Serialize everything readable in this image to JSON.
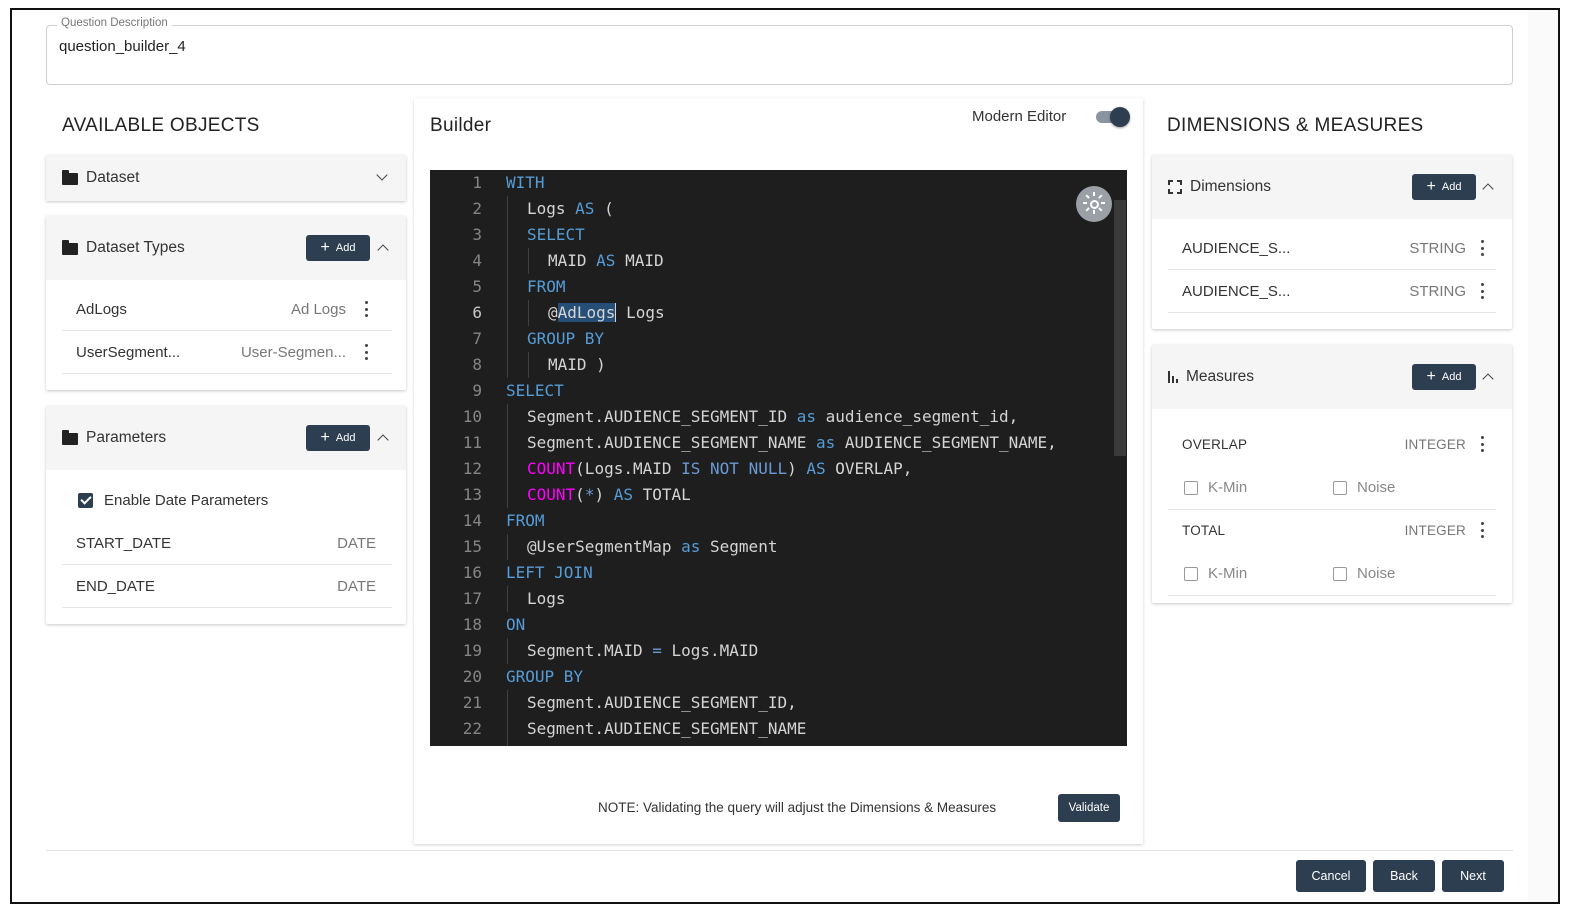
{
  "question": {
    "label": "Question Description",
    "value": "question_builder_4"
  },
  "available_objects": {
    "title": "AVAILABLE OBJECTS",
    "dataset": {
      "label": "Dataset"
    },
    "dataset_types": {
      "label": "Dataset Types",
      "add_label": "Add",
      "items": [
        {
          "name": "AdLogs",
          "type": "Ad Logs"
        },
        {
          "name": "UserSegment...",
          "type": "User-Segmen..."
        }
      ]
    },
    "parameters": {
      "label": "Parameters",
      "add_label": "Add",
      "enable_label": "Enable Date Parameters",
      "items": [
        {
          "name": "START_DATE",
          "type": "DATE"
        },
        {
          "name": "END_DATE",
          "type": "DATE"
        }
      ]
    }
  },
  "builder": {
    "title": "Builder",
    "toggle_label": "Modern Editor",
    "note": "NOTE: Validating the query will adjust the Dimensions & Measures",
    "validate_label": "Validate",
    "line_numbers": [
      "1",
      "2",
      "3",
      "4",
      "5",
      "6",
      "7",
      "8",
      "9",
      "10",
      "11",
      "12",
      "13",
      "14",
      "15",
      "16",
      "17",
      "18",
      "19",
      "20",
      "21",
      "22"
    ],
    "code": {
      "l1": {
        "kw": "WITH"
      },
      "l2": {
        "a": "Logs ",
        "kw": "AS",
        "b": " ("
      },
      "l3": {
        "kw": "SELECT"
      },
      "l4": {
        "a": "MAID ",
        "kw": "AS",
        "b": " MAID"
      },
      "l5": {
        "kw": "FROM"
      },
      "l6": {
        "a": "@",
        "sel": "AdLogs",
        "b": " Logs"
      },
      "l7": {
        "kw": "GROUP BY"
      },
      "l8": {
        "a": "MAID )"
      },
      "l9": {
        "kw": "SELECT"
      },
      "l10": {
        "a": "Segment.AUDIENCE_SEGMENT_ID ",
        "kw": "as",
        "b": " audience_segment_id,"
      },
      "l11": {
        "a": "Segment.AUDIENCE_SEGMENT_NAME ",
        "kw": "as",
        "b": " AUDIENCE_SEGMENT_NAME,"
      },
      "l12": {
        "fn": "COUNT",
        "a": "(Logs.MAID ",
        "op": "IS NOT NULL",
        "b": ") ",
        "kw": "AS",
        "c": " OVERLAP,"
      },
      "l13": {
        "fn": "COUNT",
        "a": "(",
        "op": "*",
        "b": ") ",
        "kw": "AS",
        "c": " TOTAL"
      },
      "l14": {
        "kw": "FROM"
      },
      "l15": {
        "a": "@UserSegmentMap ",
        "kw": "as",
        "b": " Segment"
      },
      "l16": {
        "kw": "LEFT JOIN"
      },
      "l17": {
        "a": "Logs"
      },
      "l18": {
        "kw": "ON"
      },
      "l19": {
        "a": "Segment.MAID ",
        "op": "=",
        "b": " Logs.MAID"
      },
      "l20": {
        "kw": "GROUP BY"
      },
      "l21": {
        "a": "Segment.AUDIENCE_SEGMENT_ID,"
      },
      "l22": {
        "a": "Segment.AUDIENCE_SEGMENT_NAME"
      }
    }
  },
  "dim_meas": {
    "title": "DIMENSIONS & MEASURES",
    "dimensions": {
      "label": "Dimensions",
      "add_label": "Add",
      "items": [
        {
          "name": "AUDIENCE_S...",
          "type": "STRING"
        },
        {
          "name": "AUDIENCE_S...",
          "type": "STRING"
        }
      ]
    },
    "measures": {
      "label": "Measures",
      "add_label": "Add",
      "items": [
        {
          "name": "OVERLAP",
          "type": "INTEGER",
          "kmin": "K-Min",
          "noise": "Noise"
        },
        {
          "name": "TOTAL",
          "type": "INTEGER",
          "kmin": "K-Min",
          "noise": "Noise"
        }
      ]
    }
  },
  "footer": {
    "cancel": "Cancel",
    "back": "Back",
    "next": "Next"
  },
  "colors": {
    "primary": "#2d3e50",
    "editor_bg": "#1e1e1e",
    "keyword": "#569cd6",
    "function": "#ff00ff"
  }
}
